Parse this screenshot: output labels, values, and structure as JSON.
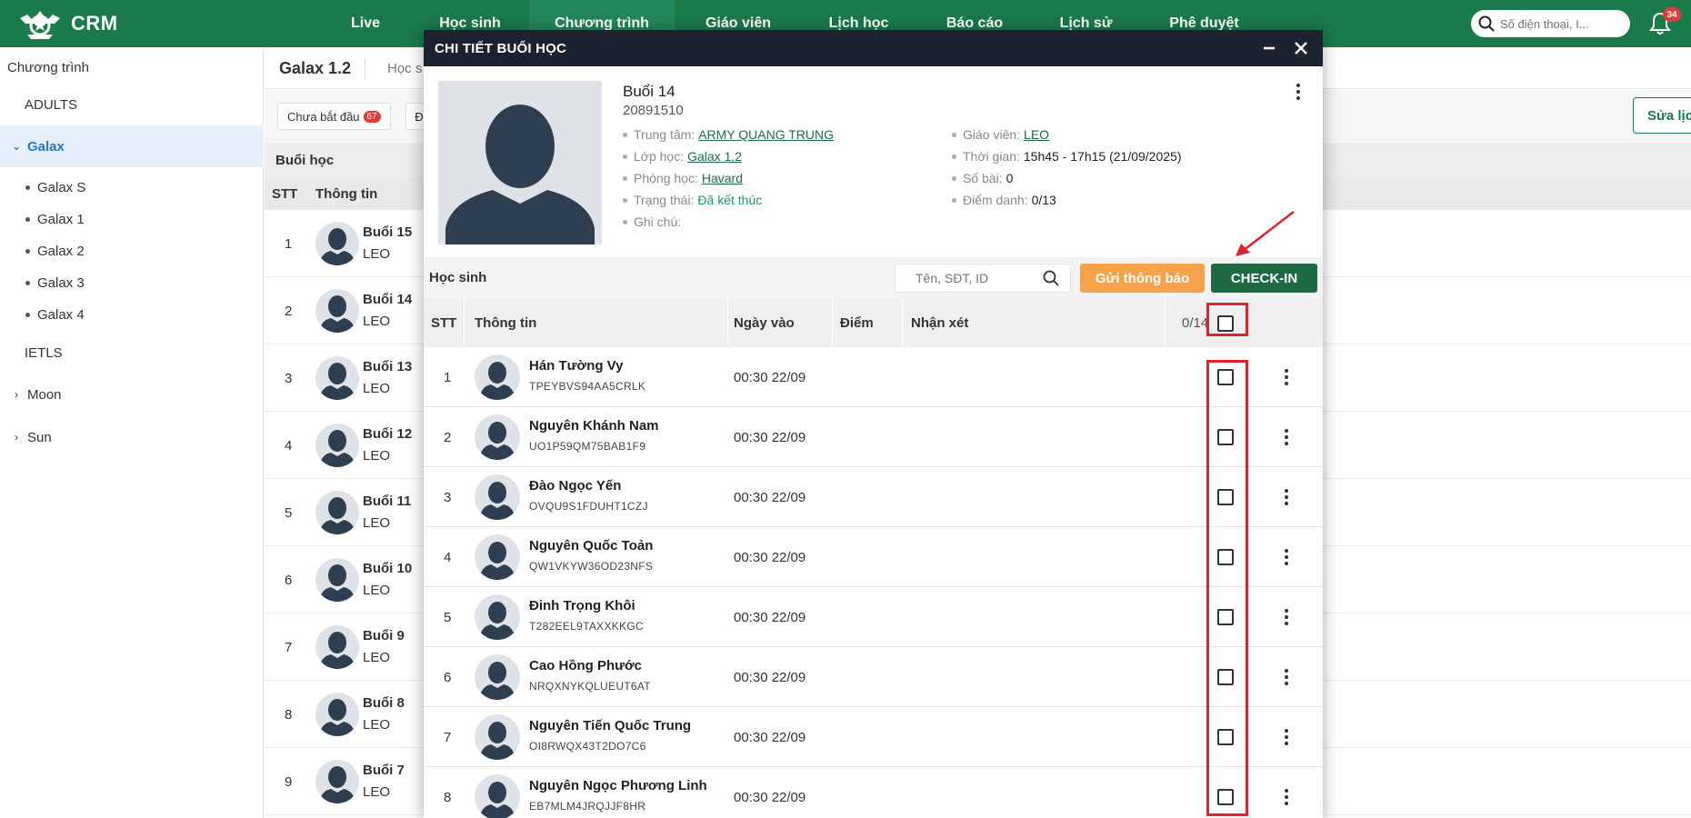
{
  "app": {
    "logo_text": "CRM",
    "accent": "#1a7a4a"
  },
  "nav": {
    "items": [
      "Live",
      "Học sinh",
      "Chương trình",
      "Giáo viên",
      "Lịch học",
      "Báo cáo",
      "Lịch sử",
      "Phê duyệt"
    ],
    "active_index": 2,
    "search_placeholder": "Số điện thoại, I...",
    "notification_count": "34"
  },
  "sidebar": {
    "title": "Chương trình",
    "groups": [
      {
        "label": "ADULTS",
        "expanded": false
      },
      {
        "label": "Galax",
        "expanded": true,
        "active": true,
        "children": [
          "Galax S",
          "Galax 1",
          "Galax 2",
          "Galax 3",
          "Galax 4"
        ]
      },
      {
        "label": "IETLS",
        "expanded": false
      },
      {
        "label": "Moon",
        "expanded": false
      },
      {
        "label": "Sun",
        "expanded": false
      }
    ]
  },
  "main": {
    "title": "Galax 1.2",
    "tab": "Học s",
    "filter_chip": "Chưa bắt đầu",
    "filter_badge": "67",
    "second_chip": "Đ",
    "edit_button": "Sửa lịc",
    "section_title": "Buổi học",
    "columns": [
      "STT",
      "Thông tin"
    ],
    "rows": [
      {
        "stt": "1",
        "name": "Buổi 15",
        "teacher": "LEO"
      },
      {
        "stt": "2",
        "name": "Buổi 14",
        "teacher": "LEO"
      },
      {
        "stt": "3",
        "name": "Buổi 13",
        "teacher": "LEO"
      },
      {
        "stt": "4",
        "name": "Buổi 12",
        "teacher": "LEO"
      },
      {
        "stt": "5",
        "name": "Buổi 11",
        "teacher": "LEO"
      },
      {
        "stt": "6",
        "name": "Buổi 10",
        "teacher": "LEO"
      },
      {
        "stt": "7",
        "name": "Buổi 9",
        "teacher": "LEO"
      },
      {
        "stt": "8",
        "name": "Buổi 8",
        "teacher": "LEO"
      },
      {
        "stt": "9",
        "name": "Buổi 7",
        "teacher": "LEO"
      }
    ]
  },
  "modal": {
    "title": "CHI TIẾT BUỔI HỌC",
    "lesson": {
      "name": "Buổi 14",
      "code": "20891510",
      "left_info": [
        {
          "label": "Trung tâm:",
          "value": "ARMY QUANG TRUNG",
          "style": "link"
        },
        {
          "label": "Lớp học:",
          "value": "Galax 1.2",
          "style": "link"
        },
        {
          "label": "Phòng học:",
          "value": "Havard",
          "style": "link"
        },
        {
          "label": "Trạng thái:",
          "value": "Đã kết thúc",
          "style": "green"
        },
        {
          "label": "Ghi chú:",
          "value": "",
          "style": "plain"
        }
      ],
      "right_info": [
        {
          "label": "Giáo viên:",
          "value": "LEO",
          "style": "link"
        },
        {
          "label": "Thời gian:",
          "value": "15h45 - 17h15 (21/09/2025)",
          "style": "plain"
        },
        {
          "label": "Số bài:",
          "value": "0",
          "style": "plain"
        },
        {
          "label": "Điểm danh:",
          "value": "0/13",
          "style": "plain"
        }
      ]
    },
    "students": {
      "label": "Học sinh",
      "search_placeholder": "Tên, SĐT, ID",
      "notify_button": "Gửi thông báo",
      "checkin_button": "CHECK-IN",
      "columns": {
        "stt": "STT",
        "info": "Thông tin",
        "date": "Ngày vào",
        "score": "Điểm",
        "comment": "Nhận xét"
      },
      "count": "0/14",
      "rows": [
        {
          "stt": "1",
          "name": "Hán Tường Vy",
          "id": "TPEYBVS94AA5CRLK",
          "date": "00:30 22/09"
        },
        {
          "stt": "2",
          "name": "Nguyên Khánh Nam",
          "id": "UO1P59QM75BAB1F9",
          "date": "00:30 22/09"
        },
        {
          "stt": "3",
          "name": "Đào Ngọc Yến",
          "id": "OVQU9S1FDUHT1CZJ",
          "date": "00:30 22/09"
        },
        {
          "stt": "4",
          "name": "Nguyên Quốc Toản",
          "id": "QW1VKYW36OD23NFS",
          "date": "00:30 22/09"
        },
        {
          "stt": "5",
          "name": "Đinh Trọng Khôi",
          "id": "T282EEL9TAXXKKGC",
          "date": "00:30 22/09"
        },
        {
          "stt": "6",
          "name": "Cao Hồng Phước",
          "id": "NRQXNYKQLUEUT6AT",
          "date": "00:30 22/09"
        },
        {
          "stt": "7",
          "name": "Nguyên Tiến Quốc Trung",
          "id": "OI8RWQX43T2DO7C6",
          "date": "00:30 22/09"
        },
        {
          "stt": "8",
          "name": "Nguyên Ngọc Phương Linh",
          "id": "EB7MLM4JRQJJF8HR",
          "date": "00:30 22/09"
        }
      ]
    }
  }
}
